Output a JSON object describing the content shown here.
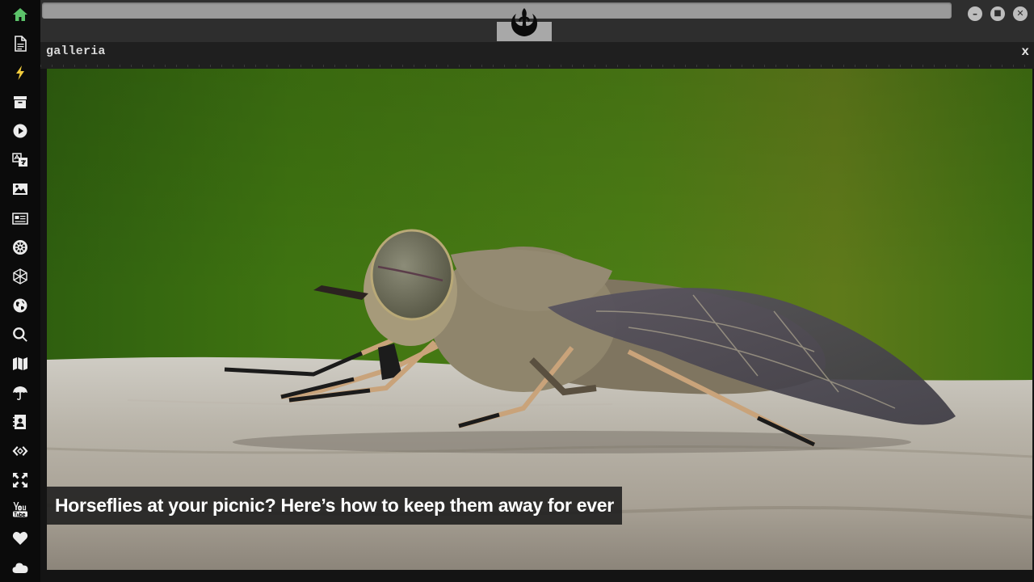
{
  "sidebar": {
    "items": [
      {
        "icon": "home-icon",
        "color": "#5cc36a"
      },
      {
        "icon": "document-icon"
      },
      {
        "icon": "bolt-icon",
        "color": "#f2cc3d"
      },
      {
        "icon": "archive-icon"
      },
      {
        "icon": "play-circle-icon"
      },
      {
        "icon": "translate-icon"
      },
      {
        "icon": "image-icon"
      },
      {
        "icon": "newspaper-icon"
      },
      {
        "icon": "galactic-empire-icon"
      },
      {
        "icon": "hexagon-net-icon"
      },
      {
        "icon": "globe-icon"
      },
      {
        "icon": "search-icon"
      },
      {
        "icon": "map-icon"
      },
      {
        "icon": "umbrella-icon"
      },
      {
        "icon": "contact-card-icon"
      },
      {
        "icon": "code-icon"
      },
      {
        "icon": "expand-icon"
      },
      {
        "icon": "youtube-icon"
      },
      {
        "icon": "heart-icon"
      },
      {
        "icon": "cloud-icon"
      }
    ]
  },
  "topbar": {
    "emblem_icon": "rebel-alliance-icon",
    "window_buttons": {
      "minimize": "–",
      "maximize": "■",
      "close": "✕"
    }
  },
  "panel": {
    "title": "galleria",
    "close_label": "x"
  },
  "viewer": {
    "caption": "Horseflies at your picnic? Here’s how to keep them away for ever"
  },
  "colors": {
    "background": "#141414",
    "sidebar": "#0b0b0b",
    "topbar": "#2e2e2e",
    "panel_header": "#1f1f1f",
    "accent_green": "#5cc36a",
    "accent_yellow": "#f2cc3d"
  }
}
